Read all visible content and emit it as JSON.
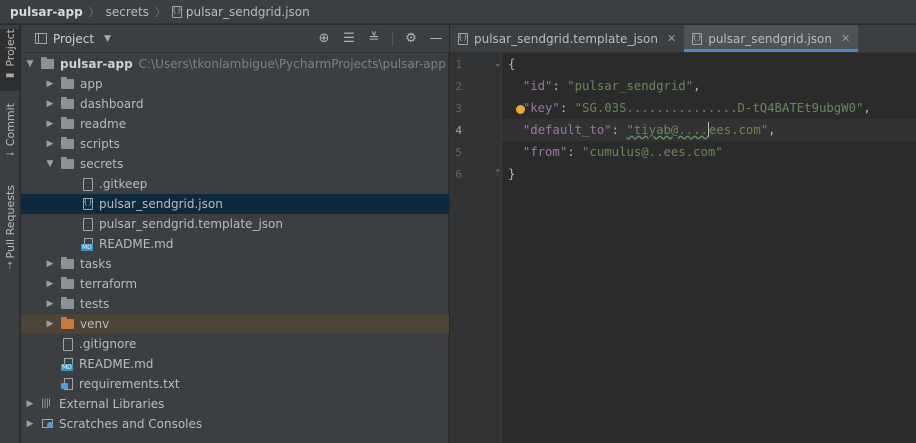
{
  "breadcrumb": {
    "project": "pulsar-app",
    "folder": "secrets",
    "file": "pulsar_sendgrid.json"
  },
  "left_strip": {
    "tabs": [
      {
        "label": "Project"
      },
      {
        "label": "Commit"
      },
      {
        "label": "Pull Requests"
      }
    ]
  },
  "project_panel": {
    "title": "Project",
    "tools": [
      "locate-icon",
      "expand-all-icon",
      "collapse-all-icon",
      "gear-icon",
      "minimize-icon"
    ],
    "tree": [
      {
        "label": "pulsar-app",
        "hint": "C:\\Users\\tkonlambigue\\PycharmProjects\\pulsar-app",
        "type": "folder",
        "depth": 0,
        "expanded": true
      },
      {
        "label": "app",
        "type": "folder",
        "depth": 1,
        "expanded": false
      },
      {
        "label": "dashboard",
        "type": "folder",
        "depth": 1,
        "expanded": false
      },
      {
        "label": "readme",
        "type": "folder",
        "depth": 1,
        "expanded": false
      },
      {
        "label": "scripts",
        "type": "folder",
        "depth": 1,
        "expanded": false
      },
      {
        "label": "secrets",
        "type": "folder",
        "depth": 1,
        "expanded": true
      },
      {
        "label": ".gitkeep",
        "type": "file",
        "depth": 2
      },
      {
        "label": "pulsar_sendgrid.json",
        "type": "json",
        "depth": 2,
        "selected": true
      },
      {
        "label": "pulsar_sendgrid.template_json",
        "type": "file",
        "depth": 2
      },
      {
        "label": "README.md",
        "type": "md",
        "depth": 2
      },
      {
        "label": "tasks",
        "type": "folder",
        "depth": 1,
        "expanded": false
      },
      {
        "label": "terraform",
        "type": "folder",
        "depth": 1,
        "expanded": false
      },
      {
        "label": "tests",
        "type": "folder",
        "depth": 1,
        "expanded": false
      },
      {
        "label": "venv",
        "type": "folder-orange",
        "depth": 1,
        "expanded": false,
        "highlighted": true
      },
      {
        "label": ".gitignore",
        "type": "file",
        "depth": 1
      },
      {
        "label": "README.md",
        "type": "md",
        "depth": 1
      },
      {
        "label": "requirements.txt",
        "type": "txt",
        "depth": 1
      },
      {
        "label": "External Libraries",
        "type": "library",
        "depth": 0,
        "expanded": false
      },
      {
        "label": "Scratches and Consoles",
        "type": "scratch",
        "depth": 0,
        "expanded": false
      }
    ]
  },
  "editor": {
    "tabs": [
      {
        "label": "pulsar_sendgrid.template_json",
        "active": false
      },
      {
        "label": "pulsar_sendgrid.json",
        "active": true
      }
    ],
    "current_line": 4,
    "lines": [
      {
        "n": "1",
        "brace": "{"
      },
      {
        "n": "2",
        "key": "\"id\"",
        "value": "\"pulsar_sendgrid\"",
        "comma": ","
      },
      {
        "n": "3",
        "key": "\"key\"",
        "value": "\"SG.03S...............D-tQ4BATEt9ubgW0\"",
        "comma": ","
      },
      {
        "n": "4",
        "key": "\"default_to\"",
        "value_a": "\"tiyab@....",
        "value_b": "ees.com\"",
        "comma": ","
      },
      {
        "n": "5",
        "key": "\"from\"",
        "value": "\"cumulus@..ees.com\""
      },
      {
        "n": "6",
        "brace": "}"
      }
    ]
  }
}
